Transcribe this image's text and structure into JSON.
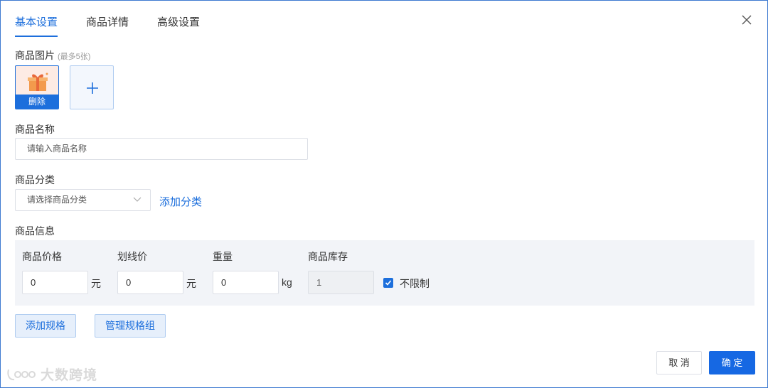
{
  "tabs": [
    {
      "label": "基本设置",
      "active": true
    },
    {
      "label": "商品详情",
      "active": false
    },
    {
      "label": "高级设置",
      "active": false
    }
  ],
  "images": {
    "label": "商品图片",
    "hint": "(最多5张)",
    "delete_label": "删除",
    "thumbnail_icon": "gift-icon",
    "add_icon": "plus-icon"
  },
  "name": {
    "label": "商品名称",
    "placeholder": "请输入商品名称"
  },
  "category": {
    "label": "商品分类",
    "placeholder": "请选择商品分类",
    "add_link": "添加分类"
  },
  "info": {
    "label": "商品信息",
    "price_label": "商品价格",
    "price_value": "0",
    "price_unit": "元",
    "strike_label": "划线价",
    "strike_value": "0",
    "strike_unit": "元",
    "weight_label": "重量",
    "weight_value": "0",
    "weight_unit": "kg",
    "stock_label": "商品库存",
    "stock_value": "1",
    "unlimited_label": "不限制",
    "unlimited_checked": true
  },
  "spec": {
    "add_button": "添加规格",
    "manage_button": "管理规格组"
  },
  "footer": {
    "cancel": "取 消",
    "confirm": "确 定"
  },
  "watermark": {
    "text": "大数跨境"
  },
  "colors": {
    "accent": "#1d6fdc",
    "primary_button": "#1668e3",
    "info_bg": "#f2f4f8"
  }
}
